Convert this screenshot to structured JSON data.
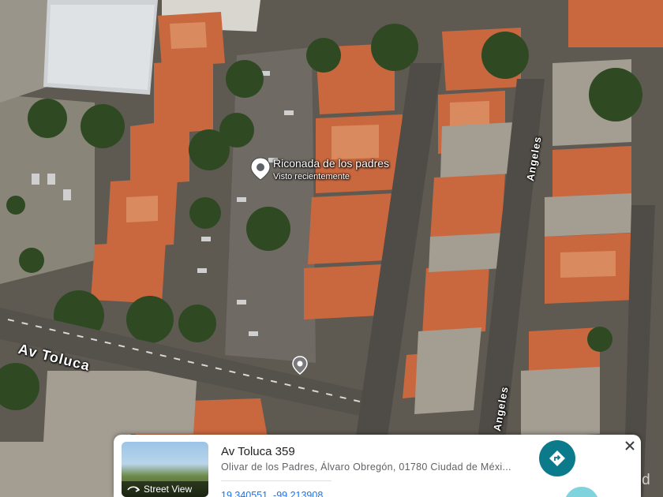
{
  "map": {
    "place": {
      "name": "Riconada de los padres",
      "subtitle": "Visto recientemente",
      "icon": "location-pin-icon"
    },
    "roads": [
      {
        "id": "toluca",
        "name": "Av Toluca"
      },
      {
        "id": "angeles-1",
        "name": "Angeles"
      },
      {
        "id": "angeles-2",
        "name": "Angeles"
      }
    ],
    "small_pin_icon": "map-marker-icon"
  },
  "card": {
    "streetview_label": "Street View",
    "streetview_icon": "streetview-arrow-icon",
    "title": "Av Toluca 359",
    "address": "Olivar de los Padres, Álvaro Obregón, 01780 Ciudad de Méxi...",
    "coordinates": "19.340551, -99.213908",
    "directions_icon": "directions-icon",
    "close_icon": "close-icon",
    "accent_color": "#0b7b8b"
  },
  "watermark": "Activar Wind"
}
